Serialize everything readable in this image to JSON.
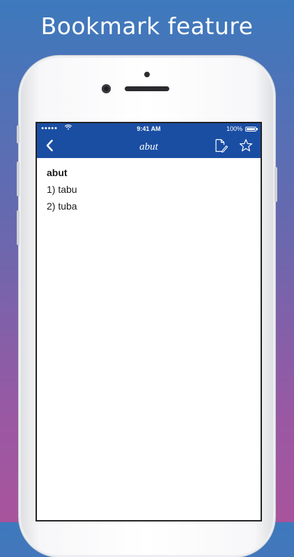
{
  "banner": {
    "headline": "Bookmark feature"
  },
  "statusbar": {
    "signal": "●●●●●",
    "time": "9:41 AM",
    "battery": "100%"
  },
  "navbar": {
    "title": "abut",
    "back_icon": "chevron-left-icon",
    "note_icon": "note-edit-icon",
    "star_icon": "star-outline-icon"
  },
  "entry": {
    "word": "abut",
    "meanings": [
      "1) tabu",
      "2) tuba"
    ]
  },
  "colors": {
    "bar": "#1a4ea3",
    "gradient_top": "#3d79bd",
    "gradient_bottom": "#a8549c"
  }
}
